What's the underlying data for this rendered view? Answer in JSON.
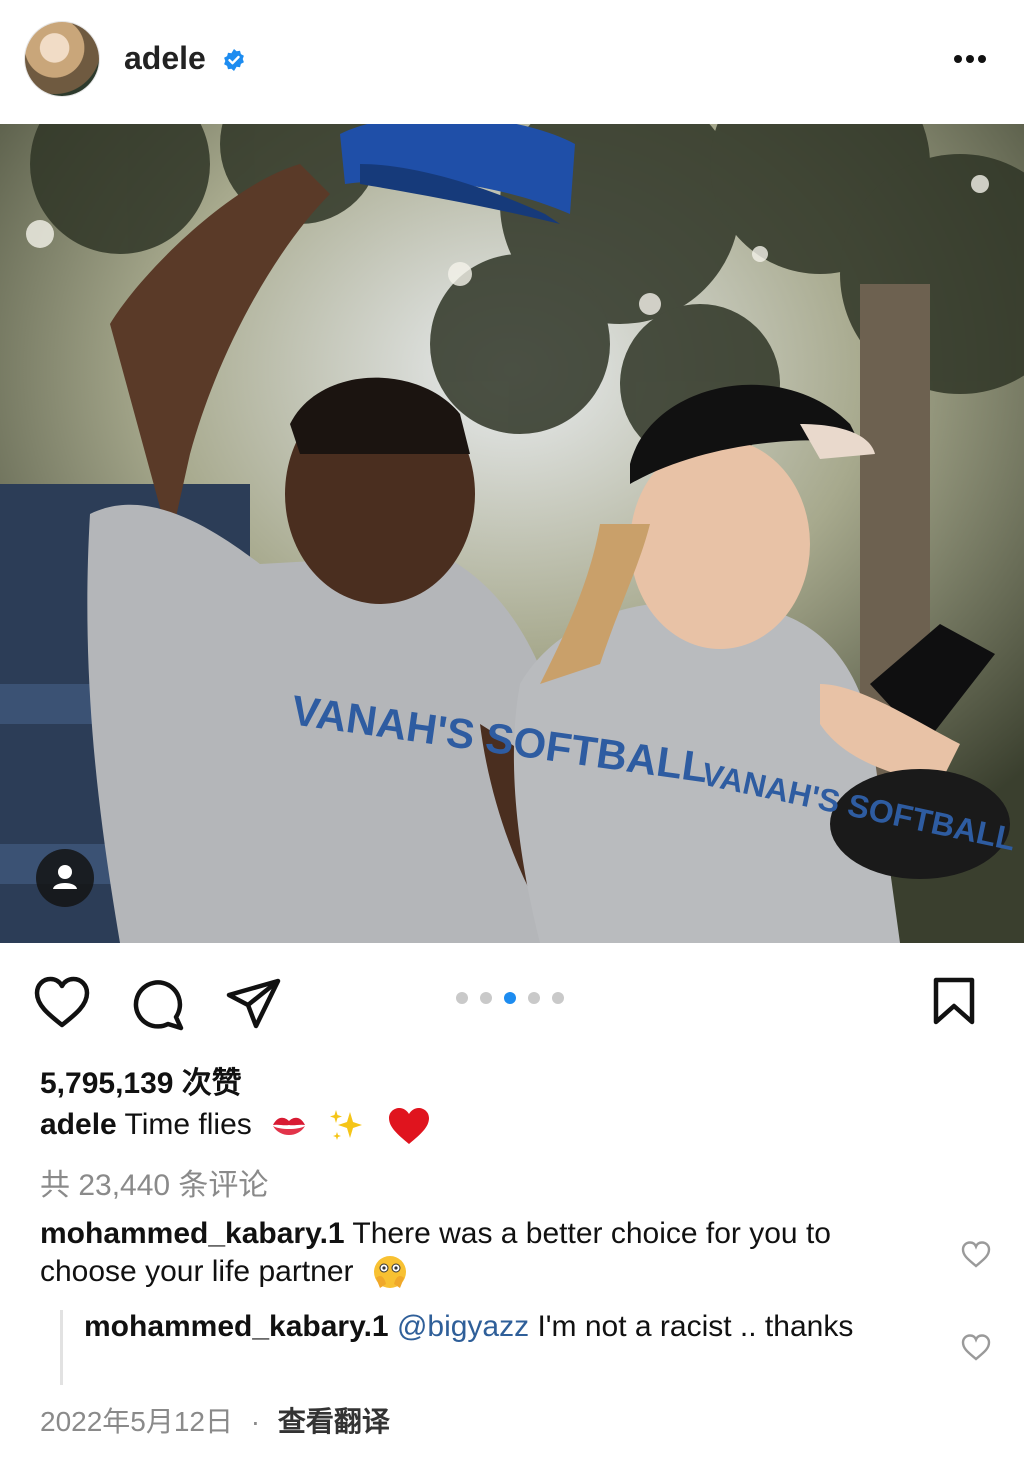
{
  "post": {
    "username": "adele",
    "verified": true,
    "likes": "5,795,139 次赞",
    "caption_user": "adele",
    "caption_text": "Time flies",
    "caption_emojis": [
      "kiss-mark",
      "sparkles",
      "red-heart"
    ],
    "comments_count": "共 23,440 条评论",
    "carousel": {
      "count": 5,
      "active_index": 2
    },
    "date": "2022年5月12日",
    "separator": "·",
    "translate": "查看翻译"
  },
  "photo_text": {
    "shirt_left": "VANAH'S SOFTBALL",
    "shirt_right": "VANAH'S SOFTBALL"
  },
  "comments": [
    {
      "user": "mohammed_kabary.1",
      "text": "There was a better choice for you to choose your life partner",
      "emoji": "flushed-face-hands"
    },
    {
      "user": "mohammed_kabary.1",
      "mention": "@bigyazz",
      "text": "I'm not a racist .. thanks"
    }
  ],
  "colors": {
    "accent": "#1d8cf0",
    "mention": "#2f5f99",
    "muted": "#8a8a8a"
  }
}
